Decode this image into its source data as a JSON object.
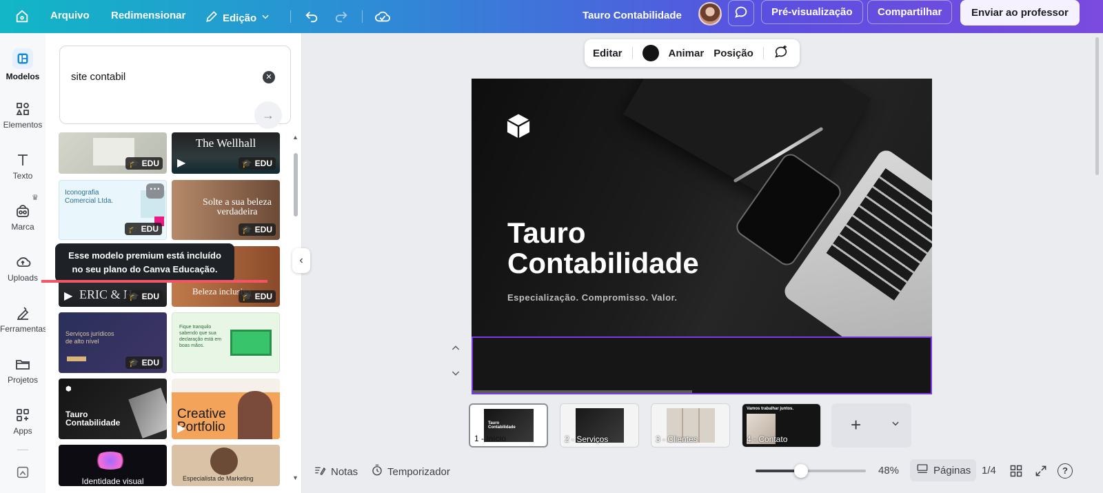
{
  "topbar": {
    "arquivo": "Arquivo",
    "redimensionar": "Redimensionar",
    "edicao": "Edição",
    "doc_title": "Tauro Contabilidade",
    "preview": "Pré-visualização",
    "share": "Compartilhar",
    "send": "Enviar ao professor",
    "gradient": [
      "#11b7c6",
      "#2f8ad6",
      "#5b4fe0",
      "#7a4bde"
    ]
  },
  "sidebar": {
    "items": [
      {
        "label": "Modelos",
        "icon": "templates-icon"
      },
      {
        "label": "Elementos",
        "icon": "elements-icon"
      },
      {
        "label": "Texto",
        "icon": "text-icon"
      },
      {
        "label": "Marca",
        "icon": "brand-icon"
      },
      {
        "label": "Uploads",
        "icon": "upload-icon"
      },
      {
        "label": "Ferramentas",
        "icon": "tools-icon"
      },
      {
        "label": "Projetos",
        "icon": "folder-icon"
      },
      {
        "label": "Apps",
        "icon": "apps-icon"
      }
    ]
  },
  "search": {
    "value": "site contabil"
  },
  "templates": {
    "edu_badge": "EDU",
    "items": [
      {
        "text": ""
      },
      {
        "text": "The Wellhall"
      },
      {
        "text": "Iconografia Comercial Ltda."
      },
      {
        "text": "Solte a sua beleza verdadeira"
      },
      {
        "text": "ERIC & H"
      },
      {
        "text": "Beleza inclusiva"
      },
      {
        "text": "Serviços jurídicos de alto nível"
      },
      {
        "text": "Fique tranquilo sabendo que sua declaração está em boas mãos."
      },
      {
        "text": "Tauro Contabilidade"
      },
      {
        "text": "Creative Portfolio"
      },
      {
        "text": "Identidade visual"
      },
      {
        "text": "Especialista de Marketing"
      }
    ]
  },
  "tooltip": {
    "text": "Esse modelo premium está incluído no seu plano do Canva Educação."
  },
  "canvas_toolbar": {
    "edit": "Editar",
    "animate": "Animar",
    "position": "Posição",
    "swatch_color": "#141414"
  },
  "slide": {
    "title_line1": "Tauro",
    "title_line2": "Contabilidade",
    "subtitle": "Especialização. Compromisso. Valor.",
    "selection_color": "#7c3aed"
  },
  "pages": [
    {
      "label": "1 - Início",
      "caption": "Tauro Contabilidade"
    },
    {
      "label": "2 - Serviços"
    },
    {
      "label": "3 - Clientes"
    },
    {
      "label": "4 - Contato",
      "caption": "Vamos trabalhar juntos."
    }
  ],
  "statusbar": {
    "notes": "Notas",
    "timer": "Temporizador",
    "zoom": "48%",
    "pages_btn": "Páginas",
    "page_count": "1/4"
  }
}
